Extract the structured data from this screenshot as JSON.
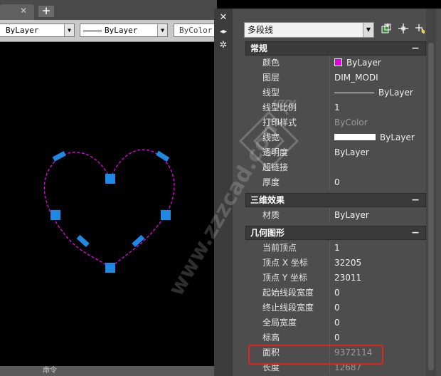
{
  "app": {
    "tab": {
      "close_glyph": "✕",
      "new_glyph": "+"
    },
    "toolbar": {
      "layer_combo": "ByLayer",
      "linetype_combo": "ByLayer",
      "plotstyle_combo": "ByColor"
    },
    "command_line": "命令"
  },
  "palette": {
    "object_type": "多段线",
    "sections": [
      {
        "title": "常规",
        "toggle": "−",
        "rows": [
          {
            "label": "颜色",
            "value": "ByLayer",
            "kind": "color",
            "swatch": "#e000e0"
          },
          {
            "label": "图层",
            "value": "DIM_MODI"
          },
          {
            "label": "线型",
            "value": "ByLayer",
            "kind": "linetype"
          },
          {
            "label": "线型比例",
            "value": "1"
          },
          {
            "label": "打印样式",
            "value": "ByColor",
            "dim": true
          },
          {
            "label": "线宽",
            "value": "ByLayer",
            "kind": "lineweight"
          },
          {
            "label": "透明度",
            "value": "ByLayer"
          },
          {
            "label": "超链接",
            "value": ""
          },
          {
            "label": "厚度",
            "value": "0"
          }
        ]
      },
      {
        "title": "三维效果",
        "toggle": "−",
        "rows": [
          {
            "label": "材质",
            "value": "ByLayer"
          }
        ]
      },
      {
        "title": "几何图形",
        "toggle": "−",
        "rows": [
          {
            "label": "当前顶点",
            "value": "1"
          },
          {
            "label": "顶点 X 坐标",
            "value": "32205"
          },
          {
            "label": "顶点 Y 坐标",
            "value": "23011"
          },
          {
            "label": "起始线段宽度",
            "value": "0"
          },
          {
            "label": "终止线段宽度",
            "value": "0"
          },
          {
            "label": "全局宽度",
            "value": "0"
          },
          {
            "label": "标高",
            "value": "0"
          },
          {
            "label": "面积",
            "value": "9372114",
            "dim": true
          },
          {
            "label": "长度",
            "value": "12687",
            "dim": true
          }
        ]
      }
    ]
  },
  "colors": {
    "polyline": "#e000e0",
    "grip": "#1e88e5",
    "highlight": "#e0231c"
  },
  "watermark": {
    "text": "www.zzzcad.com 周站长CAD",
    "logo": true
  }
}
